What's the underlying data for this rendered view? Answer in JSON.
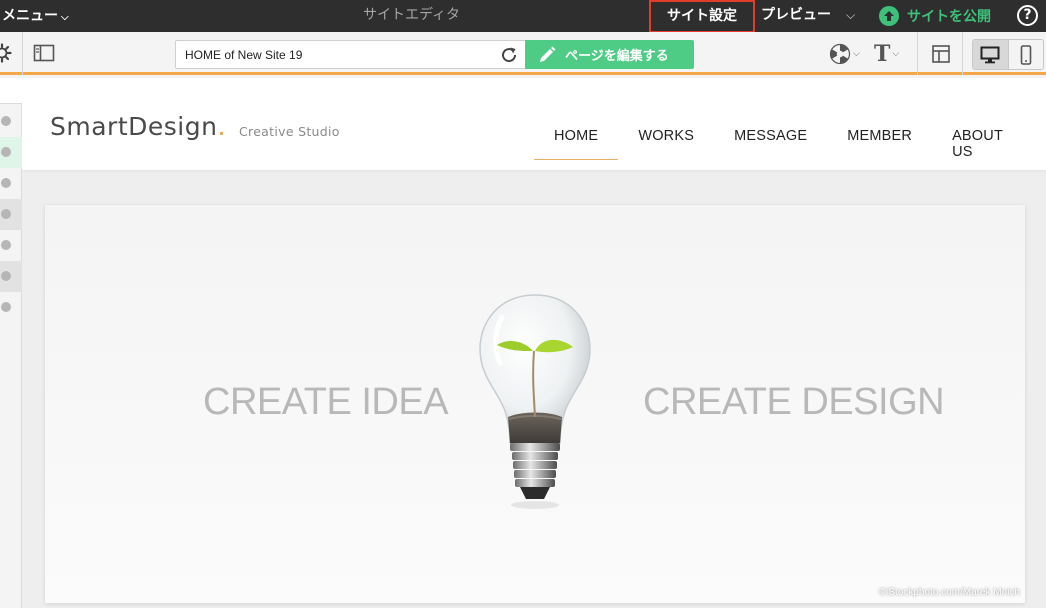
{
  "topbar": {
    "menu_label": "メニュー",
    "window_title": "サイトエディタ",
    "site_settings_label": "サイト設定",
    "preview_label": "プレビュー",
    "publish_label": "サイトを公開",
    "help_label": "?",
    "publish_color": "#3ec07a",
    "highlight_color": "#e23c2b"
  },
  "toolbar": {
    "page_selector_value": "HOME of New Site 19",
    "edit_page_label": "ページを編集する",
    "edit_page_color": "#4ecb84",
    "accent_line_color": "#f4a84a",
    "icons": [
      "gear-icon",
      "panel-toggle-icon",
      "reload-icon",
      "pencil-icon",
      "theme-palette-icon",
      "font-icon",
      "layout-icon",
      "desktop-icon",
      "smartphone-icon"
    ],
    "text_tool_glyph": "T"
  },
  "site": {
    "logo_text": "SmartDesign",
    "logo_dot": ".",
    "tagline": "Creative Studio",
    "nav": [
      "HOME",
      "WORKS",
      "MESSAGE",
      "MEMBER",
      "ABOUT US"
    ],
    "active_nav": "HOME",
    "hero_left_text": "CREATE IDEA",
    "hero_right_text": "CREATE DESIGN",
    "hero_credit": "©iStockphoto.com/Marek Mnich"
  }
}
